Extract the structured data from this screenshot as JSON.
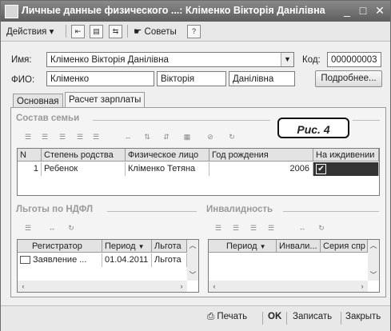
{
  "window": {
    "title": "Личные данные физического ...: Кліменко Вікторія Данілівна",
    "controls": [
      "_",
      "□",
      "✕"
    ]
  },
  "toolbar": {
    "actions_label": "Действия",
    "tips_label": "Советы",
    "help_label": "?"
  },
  "header": {
    "name_label": "Имя:",
    "name_value": "Кліменко Вікторія Данілівна",
    "code_label": "Код:",
    "code_value": "000000003",
    "fio_label": "ФИО:",
    "surname": "Кліменко",
    "first_name": "Вікторія",
    "patronymic": "Данілівна",
    "details_button": "Подробнее..."
  },
  "tabs": [
    {
      "label": "Основная",
      "active": false
    },
    {
      "label": "Расчет зарплаты",
      "active": true
    }
  ],
  "family": {
    "section_title": "Состав семьи",
    "callout": "Рис. 4",
    "columns": [
      "N",
      "Степень родства",
      "Физическое лицо",
      "Год рождения",
      "На иждивении"
    ],
    "rows": [
      {
        "n": "1",
        "relation": "Ребенок",
        "person": "Кліменко Тетяна",
        "year": "2006",
        "dependent": "✔"
      }
    ]
  },
  "ndfl": {
    "section_title": "Льготы по НДФЛ",
    "columns": [
      "Регистратор",
      "Период",
      "Льгота"
    ],
    "rows": [
      {
        "registrar": "Заявление ...",
        "period": "01.04.2011",
        "benefit": "Льгота"
      }
    ]
  },
  "disability": {
    "section_title": "Инвалидность",
    "columns": [
      "Период",
      "Инвали...",
      "Серия спр"
    ]
  },
  "bottom": {
    "print_label": "Печать",
    "ok_label": "OK",
    "save_label": "Записать",
    "close_label": "Закрыть"
  }
}
